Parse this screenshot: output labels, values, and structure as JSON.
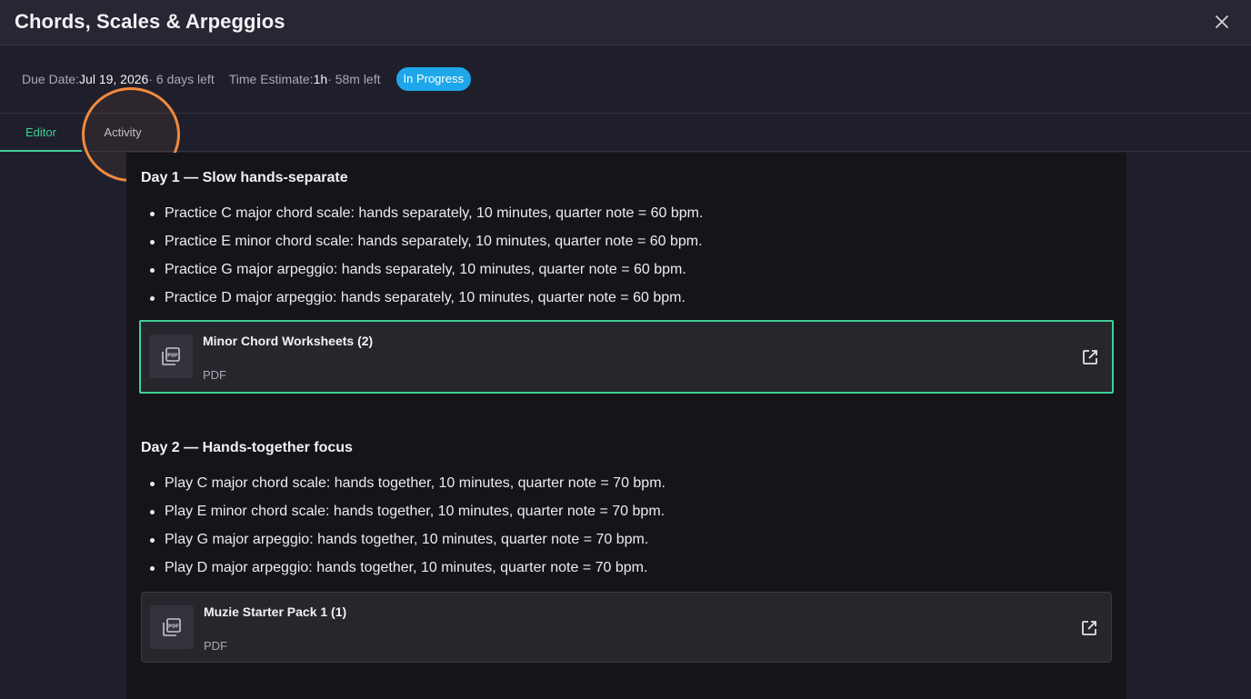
{
  "header": {
    "title": "Chords, Scales & Arpeggios",
    "close_icon": "close-icon"
  },
  "meta": {
    "due_label": "Due Date: ",
    "due_date": "Jul 19, 2026",
    "due_left": " · 6 days left",
    "time_label": "Time Estimate: ",
    "time_value": "1h",
    "time_left": " · 58m left",
    "status": "In Progress",
    "status_color": "#1ea7ea"
  },
  "tabs": [
    {
      "label": "Editor",
      "active": true
    },
    {
      "label": "Activity",
      "active": false
    }
  ],
  "accent_color": "#3ecf95",
  "highlight_color": "#f28a3c",
  "days": [
    {
      "title": "Day 1 — Slow hands-separate",
      "items": [
        "Practice C major chord scale: hands separately, 10 minutes, quarter note = 60 bpm.",
        "Practice E minor chord scale: hands separately, 10 minutes, quarter note = 60 bpm.",
        "Practice G major arpeggio: hands separately, 10 minutes, quarter note = 60 bpm.",
        "Practice D major arpeggio: hands separately, 10 minutes, quarter note = 60 bpm."
      ],
      "attachment": {
        "name": "Minor Chord Worksheets (2)",
        "type": "PDF",
        "icon": "pdf-file-icon",
        "selected": true
      }
    },
    {
      "title": "Day 2 — Hands-together focus",
      "items": [
        "Play C major chord scale: hands together, 10 minutes, quarter note = 70 bpm.",
        "Play E minor chord scale: hands together, 10 minutes, quarter note = 70 bpm.",
        "Play G major arpeggio: hands together, 10 minutes, quarter note = 70 bpm.",
        "Play D major arpeggio: hands together, 10 minutes, quarter note = 70 bpm."
      ],
      "attachment": {
        "name": "Muzie Starter Pack 1 (1)",
        "type": "PDF",
        "icon": "pdf-file-icon",
        "selected": false
      }
    }
  ]
}
